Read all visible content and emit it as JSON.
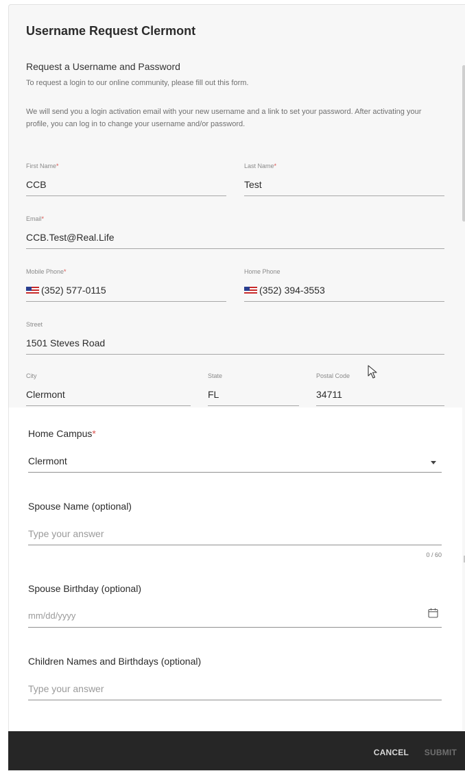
{
  "dialog": {
    "title": "Username Request Clermont",
    "intro_heading": "Request a Username and Password",
    "intro_sub": "To request a login to our online community, please fill out this form.",
    "intro_body": "We will send you a login activation email with your new username and a link to set your password. After activating your profile, you can log in to change your username and/or password."
  },
  "fields": {
    "first_name": {
      "label": "First Name",
      "value": "CCB",
      "required": true
    },
    "last_name": {
      "label": "Last Name",
      "value": "Test",
      "required": true
    },
    "email": {
      "label": "Email",
      "value": "CCB.Test@Real.Life",
      "required": true
    },
    "mobile_phone": {
      "label": "Mobile Phone",
      "value": "(352) 577-0115",
      "required": true
    },
    "home_phone": {
      "label": "Home Phone",
      "value": "(352) 394-3553",
      "required": false
    },
    "street": {
      "label": "Street",
      "value": "1501 Steves Road"
    },
    "city": {
      "label": "City",
      "value": "Clermont"
    },
    "state": {
      "label": "State",
      "value": "FL"
    },
    "postal_code": {
      "label": "Postal Code",
      "value": "34711"
    }
  },
  "questions": {
    "home_campus": {
      "label": "Home Campus",
      "value": "Clermont",
      "required": true
    },
    "spouse_name": {
      "label": "Spouse Name (optional)",
      "placeholder": "Type your answer",
      "counter": "0 / 60"
    },
    "spouse_birthday": {
      "label": "Spouse Birthday (optional)",
      "placeholder": "mm/dd/yyyy"
    },
    "children": {
      "label": "Children Names and Birthdays (optional)",
      "placeholder": "Type your answer"
    }
  },
  "required_mark": "*",
  "footer": {
    "cancel": "CANCEL",
    "submit": "SUBMIT"
  },
  "colors": {
    "required": "#d9534f",
    "footer_bg": "#262626"
  },
  "icons": [
    "us-flag-icon",
    "mouse-cursor-icon",
    "dropdown-caret-icon",
    "calendar-icon"
  ]
}
